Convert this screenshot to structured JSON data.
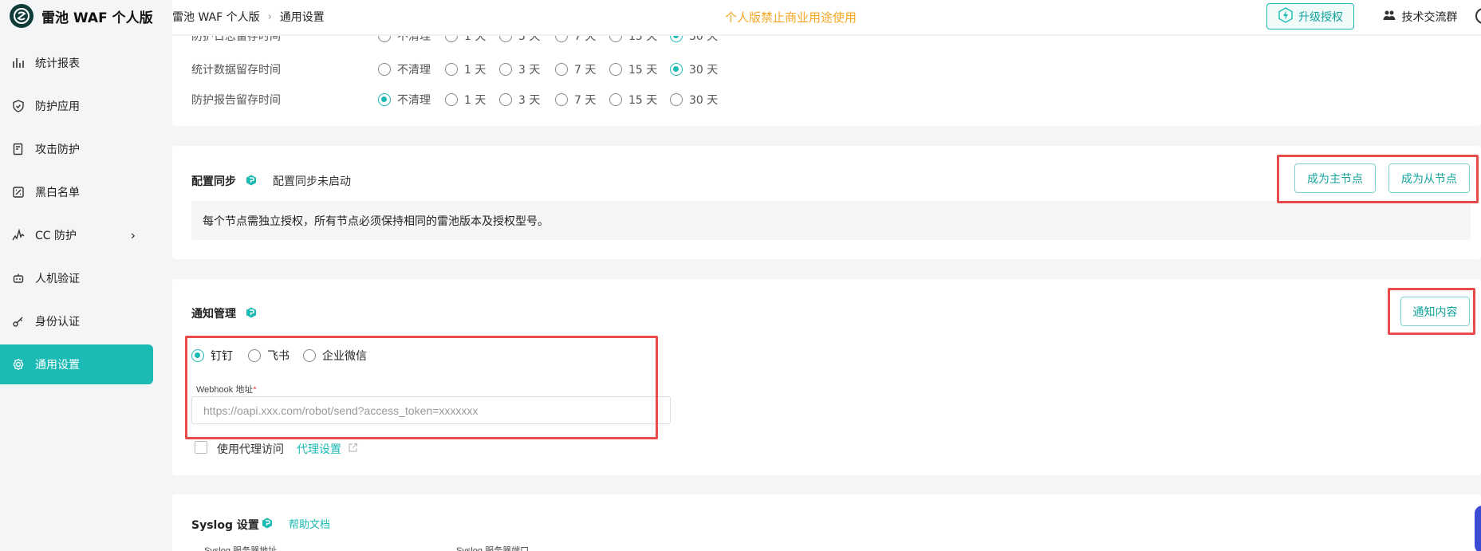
{
  "app": {
    "name": "雷池 WAF 个人版"
  },
  "header": {
    "breadcrumb": [
      "雷池 WAF 个人版",
      "通用设置"
    ],
    "notice": "个人版禁止商业用途使用",
    "upgrade_label": "升级授权",
    "group_label": "技术交流群"
  },
  "sidebar": {
    "items": [
      {
        "label": "统计报表",
        "icon": "bar-chart-icon"
      },
      {
        "label": "防护应用",
        "icon": "shield-icon"
      },
      {
        "label": "攻击防护",
        "icon": "document-shield-icon"
      },
      {
        "label": "黑白名单",
        "icon": "list-filter-icon"
      },
      {
        "label": "CC 防护",
        "icon": "pulse-icon"
      },
      {
        "label": "人机验证",
        "icon": "robot-icon"
      },
      {
        "label": "身份认证",
        "icon": "key-icon"
      },
      {
        "label": "通用设置",
        "icon": "gear-icon",
        "active": true
      }
    ]
  },
  "retention": {
    "options": [
      "不清理",
      "1 天",
      "3 天",
      "7 天",
      "15 天",
      "30 天"
    ],
    "rows": [
      {
        "label": "防护日志留存时间",
        "selected": 5
      },
      {
        "label": "统计数据留存时间",
        "selected": 5
      },
      {
        "label": "防护报告留存时间",
        "selected": 0
      }
    ]
  },
  "sync": {
    "title": "配置同步",
    "status": "配置同步未启动",
    "master_btn": "成为主节点",
    "slave_btn": "成为从节点",
    "info": "每个节点需独立授权，所有节点必须保持相同的雷池版本及授权型号。"
  },
  "notify": {
    "title": "通知管理",
    "content_btn": "通知内容",
    "channels": [
      "钉钉",
      "飞书",
      "企业微信"
    ],
    "selected_channel": 0,
    "webhook_label": "Webhook 地址",
    "webhook_required": "*",
    "webhook_placeholder": "https://oapi.xxx.com/robot/send?access_token=xxxxxxx",
    "proxy_label": "使用代理访问",
    "proxy_link": "代理设置"
  },
  "syslog": {
    "title": "Syslog 设置",
    "help_link": "帮助文档",
    "server_addr_label": "Syslog 服务器地址",
    "server_port_label": "Syslog 服务器端口"
  },
  "colors": {
    "accent": "#1bbab4",
    "highlight": "#e94b4b",
    "notice": "#f5a623"
  }
}
